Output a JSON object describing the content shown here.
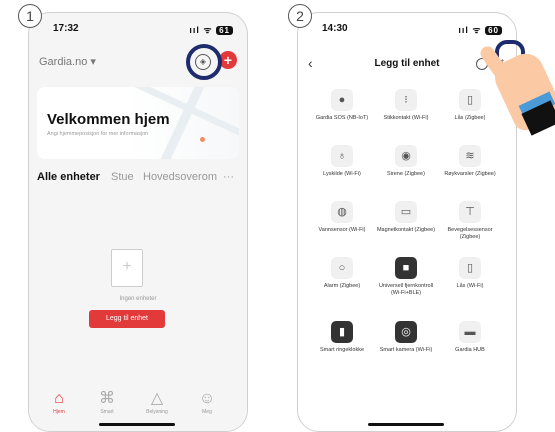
{
  "steps": [
    "1",
    "2"
  ],
  "phone1": {
    "status_time": "17:32",
    "status_icons": "ııl ᯤ",
    "battery": "61",
    "brand": "Gardia.no ▾",
    "welcome_title": "Velkommen hjem",
    "welcome_subtitle": "Angi hjemmeposisjon for mer informasjon",
    "tabs": [
      "Alle enheter",
      "Stue",
      "Hovedsoverom",
      "···"
    ],
    "empty_text": "Ingen enheter",
    "add_button": "Legg til enhet",
    "nav": [
      {
        "label": "Hjem",
        "icon": "home-icon"
      },
      {
        "label": "Smart",
        "icon": "smart-icon"
      },
      {
        "label": "Belysning",
        "icon": "lighting-icon"
      },
      {
        "label": "Meg",
        "icon": "profile-icon"
      }
    ]
  },
  "phone2": {
    "status_time": "14:30",
    "status_icons": "ııl ᯤ",
    "battery": "60",
    "title": "Legg til enhet",
    "devices": [
      {
        "name": "Gardia SOS (NB-IoT)",
        "icon": "sos-icon"
      },
      {
        "name": "Stikkontakt (Wi-Fi)",
        "icon": "plug-icon"
      },
      {
        "name": "Lås (Zigbee)",
        "icon": "lock-icon"
      },
      {
        "name": "Lyskilde (Wi-Fi)",
        "icon": "bulb-icon"
      },
      {
        "name": "Sirene (Zigbee)",
        "icon": "siren-icon"
      },
      {
        "name": "Røykvarsler (Zigbee)",
        "icon": "smoke-icon"
      },
      {
        "name": "Vannsensor (Wi-Fi)",
        "icon": "water-icon"
      },
      {
        "name": "Magnetkontakt (Zigbee)",
        "icon": "magnet-icon"
      },
      {
        "name": "Bevegelsessensor (Zigbee)",
        "icon": "motion-icon"
      },
      {
        "name": "Alarm (Zigbee)",
        "icon": "alarm-icon"
      },
      {
        "name": "Universell fjernkontroll (Wi-Fi+BLE)",
        "icon": "remote-icon"
      },
      {
        "name": "Lås (Wi-Fi)",
        "icon": "lock-icon"
      },
      {
        "name": "Smart ringeklokke",
        "icon": "doorbell-icon"
      },
      {
        "name": "Smart kamera (Wi-Fi)",
        "icon": "camera-icon"
      },
      {
        "name": "Gardia HUB",
        "icon": "hub-icon"
      }
    ]
  },
  "colors": {
    "accent": "#e23a3a",
    "highlight": "#1e2c6e"
  }
}
